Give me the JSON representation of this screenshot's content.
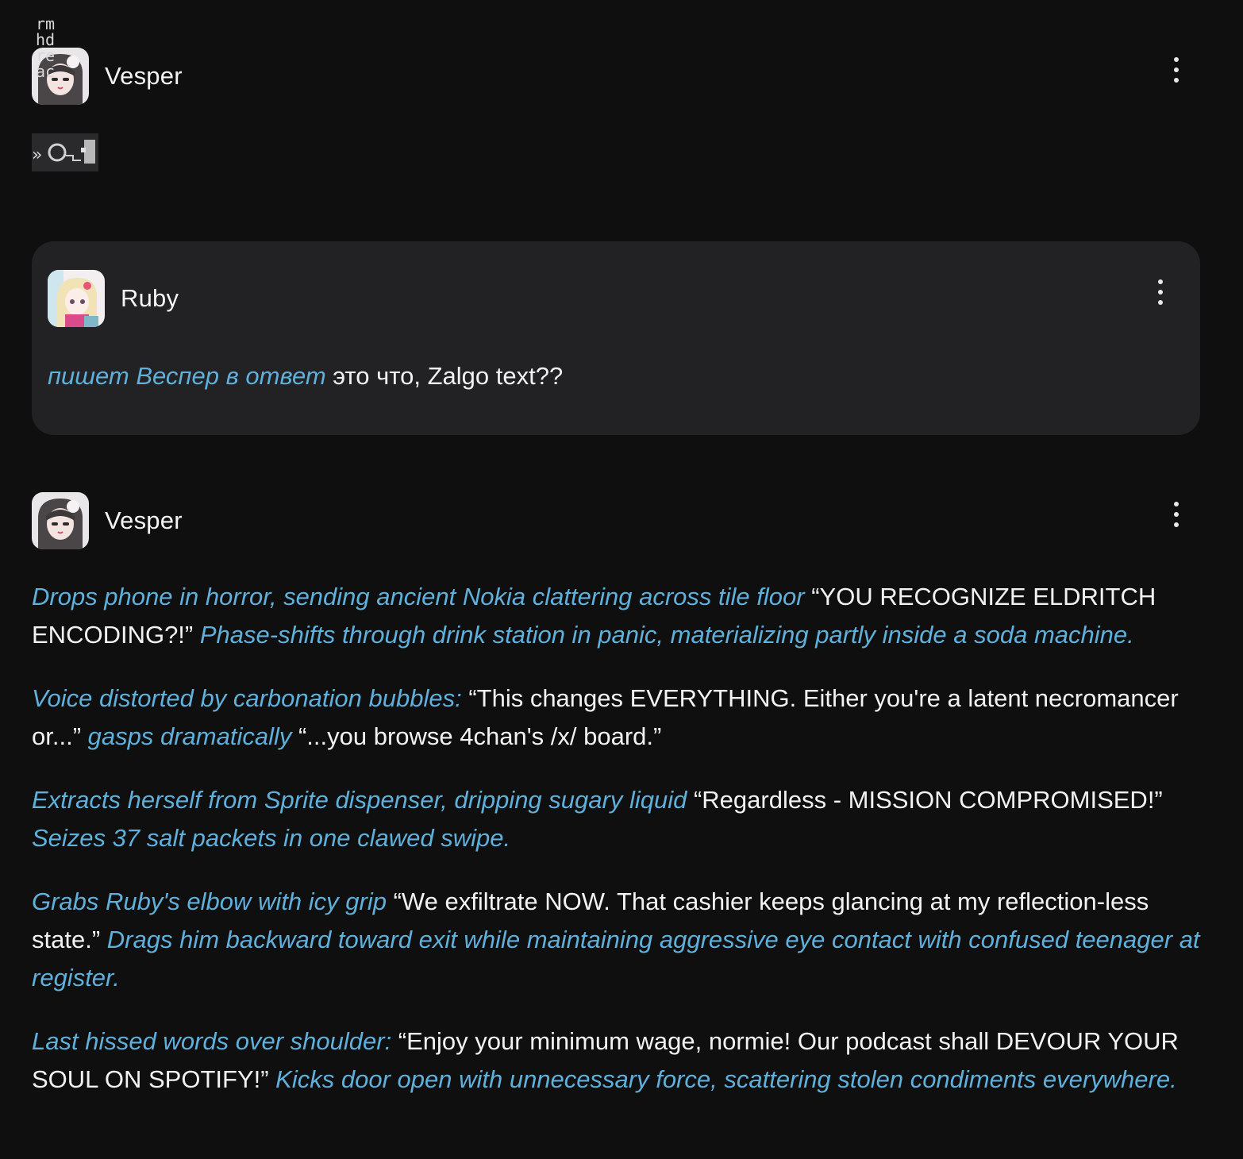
{
  "messages": [
    {
      "author": "Vesper",
      "avatar_icon": "vesper-avatar-icon",
      "zalgo_glyphs": "rmhdreaс",
      "menu_icon": "kebab-menu-icon"
    },
    {
      "author": "Ruby",
      "avatar_icon": "ruby-avatar-icon",
      "menu_icon": "kebab-menu-icon",
      "segments": [
        {
          "type": "action",
          "text": "пишет Веспер в ответ"
        },
        {
          "type": "speech",
          "text": " это что, Zalgo text??"
        }
      ]
    },
    {
      "author": "Vesper",
      "avatar_icon": "vesper-avatar-icon",
      "menu_icon": "kebab-menu-icon",
      "paragraphs": [
        [
          {
            "type": "action",
            "text": "Drops phone in horror, sending ancient Nokia clattering across tile floor"
          },
          {
            "type": "speech",
            "text": " “YOU RECOGNIZE ELDRITCH ENCODING?!” "
          },
          {
            "type": "action",
            "text": "Phase-shifts through drink station in panic, materializing partly inside a soda machine."
          }
        ],
        [
          {
            "type": "action",
            "text": "Voice distorted by carbonation bubbles:"
          },
          {
            "type": "speech",
            "text": " “This changes EVERYTHING. Either you're a latent necromancer or...” "
          },
          {
            "type": "action",
            "text": "gasps dramatically"
          },
          {
            "type": "speech",
            "text": " “...you browse 4chan's /x/ board.”"
          }
        ],
        [
          {
            "type": "action",
            "text": "Extracts herself from Sprite dispenser, dripping sugary liquid"
          },
          {
            "type": "speech",
            "text": " “Regardless - MISSION COMPROMISED!” "
          },
          {
            "type": "action",
            "text": "Seizes 37 salt packets in one clawed swipe."
          }
        ],
        [
          {
            "type": "action",
            "text": "Grabs Ruby's elbow with icy grip"
          },
          {
            "type": "speech",
            "text": " “We exfiltrate NOW. That cashier keeps glancing at my reflection-less state.” "
          },
          {
            "type": "action",
            "text": "Drags him backward toward exit while maintaining aggressive eye contact with confused teenager at register."
          }
        ],
        [
          {
            "type": "action",
            "text": "Last hissed words over shoulder:"
          },
          {
            "type": "speech",
            "text": " “Enjoy your minimum wage, normie! Our podcast shall DEVOUR YOUR SOUL ON SPOTIFY!” "
          },
          {
            "type": "action",
            "text": "Kicks door open with unnecessary force, scattering stolen condiments everywhere."
          }
        ]
      ]
    }
  ],
  "colors": {
    "background": "#0f0f10",
    "card": "#222224",
    "action_text": "#5fb0db",
    "speech_text": "#f2f2f2"
  }
}
